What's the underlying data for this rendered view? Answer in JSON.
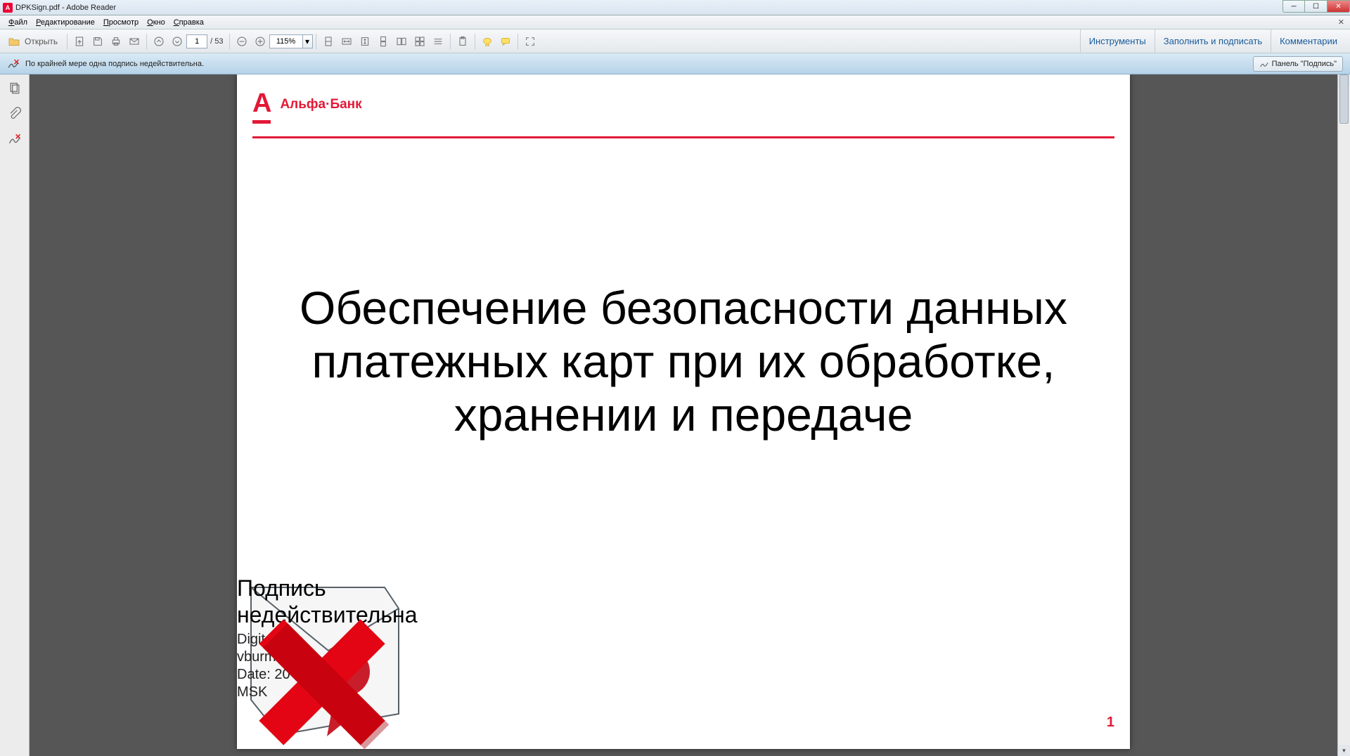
{
  "titlebar": {
    "title": "DPKSign.pdf - Adobe Reader",
    "app_icon": "pdf"
  },
  "window_buttons": {
    "min": "minimize-icon",
    "max": "maximize-icon",
    "close": "close-icon"
  },
  "menubar": {
    "items": [
      "Файл",
      "Редактирование",
      "Просмотр",
      "Окно",
      "Справка"
    ]
  },
  "toolbar": {
    "open_label": "Открыть",
    "page_current": "1",
    "page_total": "/ 53",
    "zoom_value": "115%",
    "right_tabs": [
      "Инструменты",
      "Заполнить и подписать",
      "Комментарии"
    ],
    "icons": {
      "open": "folder-icon",
      "export": "export-pdf-icon",
      "save": "save-icon",
      "print": "print-icon",
      "mail": "mail-icon",
      "prev": "page-up-icon",
      "next": "page-down-icon",
      "zoom_out": "zoom-out-icon",
      "zoom_in": "zoom-in-icon",
      "fit1": "fit-page-icon",
      "fit2": "fit-width-icon",
      "fit3": "fit-visible-icon",
      "scroll": "scrolling-icon",
      "two1": "two-page-icon",
      "two2": "two-page-scroll-icon",
      "cont": "continuous-icon",
      "clip": "clipboard-icon",
      "hl": "highlight-icon",
      "note": "comment-icon",
      "full": "fullscreen-icon"
    }
  },
  "sigbar": {
    "message": "По крайней мере одна подпись недействительна.",
    "panel_label": "Панель \"Подпись\""
  },
  "leftpanel": {
    "icons": [
      "thumbnails-icon",
      "attachments-icon",
      "signatures-icon"
    ]
  },
  "document": {
    "brand_letter": "А",
    "brand_name": "Альфа·Банк",
    "heading": "Обеспечение безопасности данных платежных карт при их обработке, хранении и передаче",
    "page_number": "1",
    "signature": {
      "title_line1": "Подпись",
      "title_line2": "недействительна",
      "detail_line1": "Digitally",
      "detail_line2": "vburmistr",
      "detail_line3": "Date: 20            14:46:25",
      "detail_line4": "MSK"
    }
  }
}
